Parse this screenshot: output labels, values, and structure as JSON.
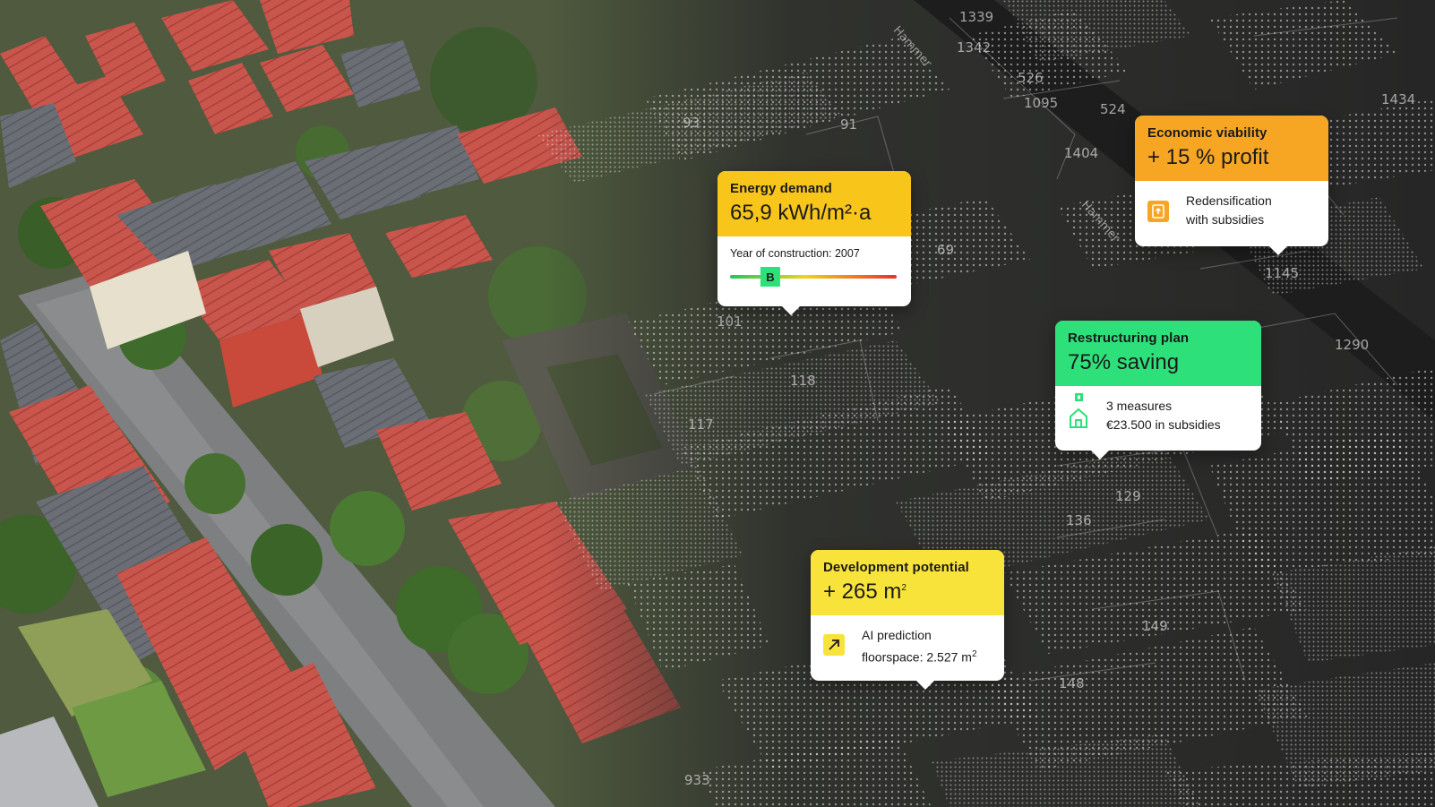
{
  "colors": {
    "energy_header": "#F8C51A",
    "economic_header": "#F6A623",
    "restructuring_header": "#2EE07A",
    "development_header": "#F8E33A",
    "scale_start": "#1EC85A",
    "scale_mid": "#F3D21B",
    "scale_end": "#E8312A",
    "marker": "#2EE07A"
  },
  "energy_demand": {
    "title": "Energy demand",
    "value": "65,9 kWh/m²·a",
    "construction_label": "Year of construction: 2007",
    "efficiency_class": "B",
    "scale_position": 0.22
  },
  "economic_viability": {
    "title": "Economic viability",
    "value": "+ 15 % profit",
    "detail_line1": "Redensification",
    "detail_line2": "with subsidies",
    "icon": "document-upload-icon"
  },
  "restructuring_plan": {
    "title": "Restructuring plan",
    "value": "75% saving",
    "detail_line1": "3 measures",
    "detail_line2": "€23.500 in subsidies",
    "icon": "house-icon"
  },
  "development_potential": {
    "title": "Development potential",
    "value_prefix": "+ 265 m",
    "value_sup": "2",
    "detail_line1": "AI prediction",
    "detail_line2_prefix": "floorspace: 2.527 m",
    "detail_line2_sup": "2",
    "icon": "arrow-up-right-icon"
  },
  "map": {
    "parcel_numbers": [
      "1339",
      "1342",
      "526",
      "1095",
      "524",
      "1434",
      "1404",
      "93",
      "91",
      "1145",
      "1290",
      "118",
      "117",
      "101",
      "129",
      "136",
      "149",
      "148",
      "933",
      "69"
    ],
    "street_labels": [
      "Hammer",
      "Hammer"
    ]
  }
}
